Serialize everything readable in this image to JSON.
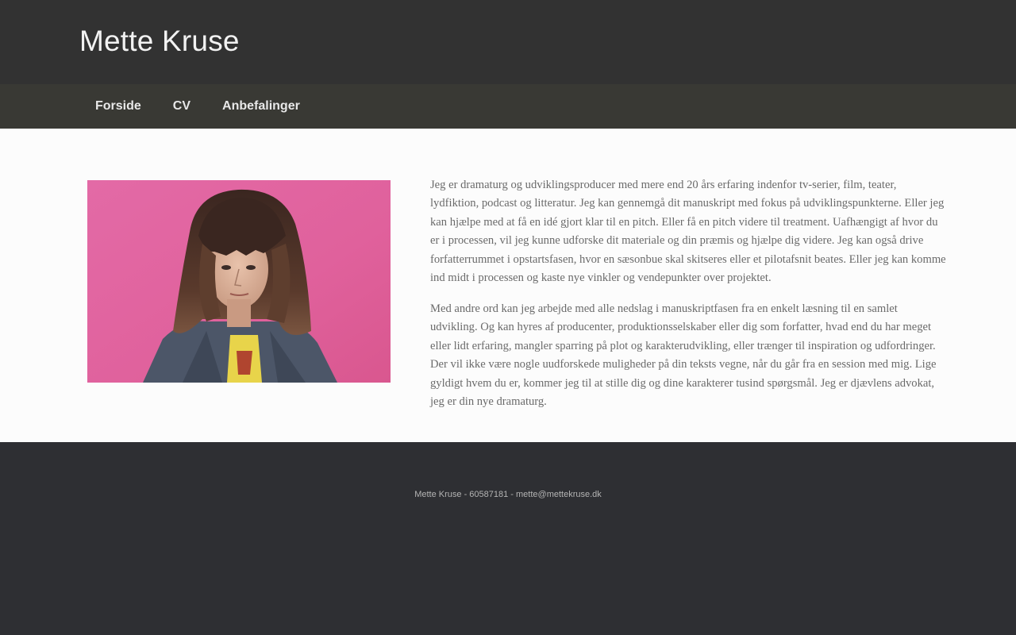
{
  "site": {
    "title": "Mette Kruse"
  },
  "nav": {
    "items": [
      {
        "label": "Forside"
      },
      {
        "label": "CV"
      },
      {
        "label": "Anbefalinger"
      }
    ]
  },
  "main": {
    "paragraphs": [
      "Jeg er dramaturg og udviklingsproducer med mere end 20 års erfaring indenfor tv-serier, film, teater, lydfiktion, podcast og litteratur. Jeg kan gennemgå dit manuskript med fokus på udviklingspunkterne. Eller jeg kan hjælpe med at få en idé gjort klar til en pitch. Eller få en pitch videre til treatment. Uafhængigt af hvor du er i processen, vil jeg kunne udforske dit materiale og din præmis og hjælpe dig videre. Jeg kan også drive forfatterrummet i opstartsfasen, hvor en sæsonbue skal skitseres eller et pilotafsnit beates. Eller jeg kan komme ind midt i processen og kaste nye vinkler og vendepunkter over projektet.",
      "Med andre ord kan jeg arbejde med alle nedslag i manuskriptfasen fra en enkelt læsning til en samlet udvikling. Og kan hyres af producenter, produktionsselskaber eller dig som forfatter, hvad end du har meget eller lidt erfaring, mangler sparring på plot og karakterudvikling, eller trænger til inspiration og udfordringer. Der vil ikke være nogle uudforskede muligheder på din teksts vegne, når du går fra en session med mig. Lige gyldigt hvem du er, kommer jeg til at stille dig og dine karakterer tusind spørgsmål. Jeg er djævlens advokat, jeg er din nye dramaturg."
    ]
  },
  "footer": {
    "text": "Mette Kruse - 60587181 - mette@mettekruse.dk"
  },
  "colors": {
    "header_bg": "#323232",
    "nav_bg": "#393934",
    "content_bg": "#fcfcfc",
    "footer_bg": "#2e2f33",
    "portrait_bg": "#e0619c"
  }
}
